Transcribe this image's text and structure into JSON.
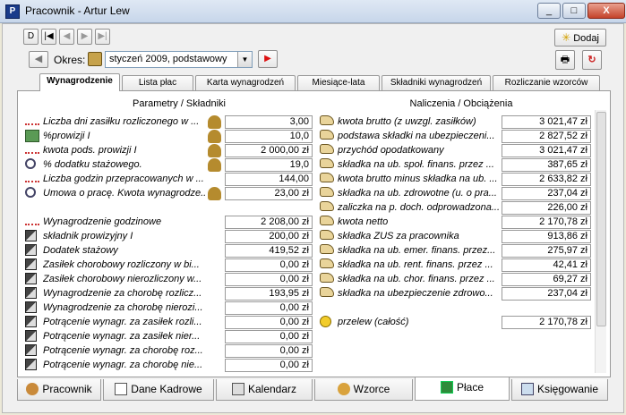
{
  "window": {
    "title": "Pracownik - Artur Lew",
    "icon": "app-icon",
    "minimize": "_",
    "maximize": "□",
    "close": "X"
  },
  "toolbar": {
    "nav_first": "D",
    "nav_prev_first": "|◀",
    "nav_prev": "◀",
    "nav_next": "▶",
    "nav_last": "▶|",
    "add_label": "Dodaj",
    "period_label": "Okres:",
    "period_value": "styczeń 2009, podstawowy"
  },
  "tabs": [
    "Wynagrodzenie",
    "Lista płac",
    "Karta wynagrodzeń",
    "Miesiące-lata",
    "Składniki wynagrodzeń",
    "Rozliczanie wzorców"
  ],
  "left": {
    "header": "Parametry / Składniki",
    "params": [
      {
        "label": "Liczba dni zasiłku rozliczonego w ...",
        "value": "3,00",
        "icon": "ruler-icon",
        "person": true
      },
      {
        "label": "%prowizji I",
        "value": "10,0",
        "icon": "calculator-icon",
        "person": true
      },
      {
        "label": "kwota pods. prowizji I",
        "value": "2 000,00 zł",
        "icon": "ruler-icon",
        "person": true
      },
      {
        "label": "% dodatku stażowego.",
        "value": "19,0",
        "icon": "search-icon",
        "person": true
      },
      {
        "label": "Liczba godzin przepracowanych w ...",
        "value": "144,00",
        "icon": "ruler-icon",
        "person": false
      },
      {
        "label": "Umowa o pracę. Kwota wynagrodze...",
        "value": "23,00 zł",
        "icon": "search-icon",
        "person": true
      }
    ],
    "components": [
      {
        "label": "Wynagrodzenie godzinowe",
        "value": "2 208,00 zł",
        "icon": "ruler-icon"
      },
      {
        "label": "składnik prowizyjny I",
        "value": "200,00 zł",
        "icon": "component-icon"
      },
      {
        "label": "Dodatek stażowy",
        "value": "419,52 zł",
        "icon": "component-icon"
      },
      {
        "label": "Zasiłek chorobowy rozliczony w bi...",
        "value": "0,00 zł",
        "icon": "component-icon"
      },
      {
        "label": "Zasiłek chorobowy nierozliczony w...",
        "value": "0,00 zł",
        "icon": "component-icon"
      },
      {
        "label": "Wynagrodzenie za chorobę rozlicz...",
        "value": "193,95 zł",
        "icon": "component-icon"
      },
      {
        "label": "Wynagrodzenie za chorobę nierozi...",
        "value": "0,00 zł",
        "icon": "component-icon"
      },
      {
        "label": "Potrącenie wynagr. za zasiłek rozli...",
        "value": "0,00 zł",
        "icon": "component-icon"
      },
      {
        "label": "Potrącenie wynagr. za zasiłek nier...",
        "value": "0,00 zł",
        "icon": "component-icon"
      },
      {
        "label": "Potrącenie wynagr. za chorobę roz...",
        "value": "0,00 zł",
        "icon": "component-icon"
      },
      {
        "label": "Potrącenie wynagr. za chorobę nie...",
        "value": "0,00 zł",
        "icon": "component-icon"
      }
    ]
  },
  "right": {
    "header": "Naliczenia / Obciążenia",
    "items": [
      {
        "label": "kwota brutto (z uwzgl. zasiłków)",
        "value": "3 021,47 zł"
      },
      {
        "label": "podstawa składki na ubezpieczeni...",
        "value": "2 827,52 zł"
      },
      {
        "label": "przychód opodatkowany",
        "value": "3 021,47 zł"
      },
      {
        "label": "składka na ub. społ. finans. przez ...",
        "value": "387,65 zł"
      },
      {
        "label": "kwota brutto minus składka na ub. ...",
        "value": "2 633,82 zł"
      },
      {
        "label": "składka na ub. zdrowotne (u. o pra...",
        "value": "237,04 zł"
      },
      {
        "label": "zaliczka na p. doch. odprowadzona...",
        "value": "226,00 zł"
      },
      {
        "label": "kwota netto",
        "value": "2 170,78 zł"
      },
      {
        "label": "składka ZUS za pracownika",
        "value": "913,86 zł"
      },
      {
        "label": "składka na ub. emer. finans. przez...",
        "value": "275,97 zł"
      },
      {
        "label": "składka na ub. rent. finans. przez ...",
        "value": "42,41 zł"
      },
      {
        "label": "składka na ub. chor. finans. przez ...",
        "value": "69,27 zł"
      },
      {
        "label": "składka na ubezpieczenie zdrowo...",
        "value": "237,04 zł"
      }
    ],
    "transfer": {
      "label": "przelew (całość)",
      "value": "2 170,78 zł"
    }
  },
  "bottom_tabs": [
    "Pracownik",
    "Dane Kadrowe",
    "Kalendarz",
    "Wzorce",
    "Płace",
    "Księgowanie"
  ]
}
